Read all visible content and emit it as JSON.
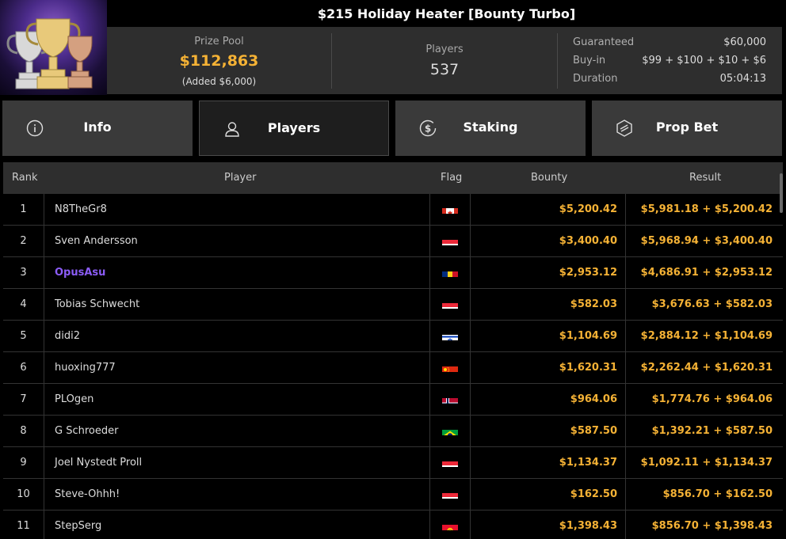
{
  "title": "$215 Holiday Heater [Bounty Turbo]",
  "prize": {
    "label": "Prize Pool",
    "value": "$112,863",
    "added": "(Added $6,000)"
  },
  "players": {
    "label": "Players",
    "value": "537"
  },
  "details": [
    {
      "key": "Guaranteed",
      "value": "$60,000"
    },
    {
      "key": "Buy-in",
      "value": "$99 + $100 + $10 + $6"
    },
    {
      "key": "Duration",
      "value": "05:04:13"
    }
  ],
  "tabs": [
    {
      "label": "Info",
      "icon": "info-icon"
    },
    {
      "label": "Players",
      "icon": "user-icon",
      "active": true
    },
    {
      "label": "Staking",
      "icon": "dollar-coin-icon"
    },
    {
      "label": "Prop Bet",
      "icon": "prop-bet-icon"
    }
  ],
  "table": {
    "headers": {
      "rank": "Rank",
      "player": "Player",
      "flag": "Flag",
      "bounty": "Bounty",
      "result": "Result"
    },
    "rows": [
      {
        "rank": "1",
        "player": "N8TheGr8",
        "flag": "canada-flag-icon",
        "bounty": "$5,200.42",
        "result": "$5,981.18 + $5,200.42"
      },
      {
        "rank": "2",
        "player": "Sven Andersson",
        "flag": "austria-flag-icon",
        "bounty": "$3,400.40",
        "result": "$5,968.94 + $3,400.40"
      },
      {
        "rank": "3",
        "player": "OpusAsu",
        "flag": "romania-flag-icon",
        "bounty": "$2,953.12",
        "result": "$4,686.91 + $2,953.12",
        "highlight": true
      },
      {
        "rank": "4",
        "player": "Tobias Schwecht",
        "flag": "austria-flag-icon",
        "bounty": "$582.03",
        "result": "$3,676.63 + $582.03"
      },
      {
        "rank": "5",
        "player": "didi2",
        "flag": "israel-flag-icon",
        "bounty": "$1,104.69",
        "result": "$2,884.12 + $1,104.69"
      },
      {
        "rank": "6",
        "player": "huoxing777",
        "flag": "china-flag-icon",
        "bounty": "$1,620.31",
        "result": "$2,262.44 + $1,620.31"
      },
      {
        "rank": "7",
        "player": "PLOgen",
        "flag": "norway-flag-icon",
        "bounty": "$964.06",
        "result": "$1,774.76 + $964.06"
      },
      {
        "rank": "8",
        "player": "G Schroeder",
        "flag": "brazil-flag-icon",
        "bounty": "$587.50",
        "result": "$1,392.21 + $587.50"
      },
      {
        "rank": "9",
        "player": "Joel Nystedt Proll",
        "flag": "austria-flag-icon",
        "bounty": "$1,134.37",
        "result": "$1,092.11 + $1,134.37"
      },
      {
        "rank": "10",
        "player": "Steve-Ohhh!",
        "flag": "austria-flag-icon",
        "bounty": "$162.50",
        "result": "$856.70 + $162.50"
      },
      {
        "rank": "11",
        "player": "StepSerg",
        "flag": "kyrgyzstan-flag-icon",
        "bounty": "$1,398.43",
        "result": "$856.70 + $1,398.43"
      }
    ]
  },
  "colors": {
    "accent": "#f5b235",
    "highlight": "#8b5cf6",
    "panel": "#2e2e2e",
    "tab": "#3a3a3a"
  }
}
